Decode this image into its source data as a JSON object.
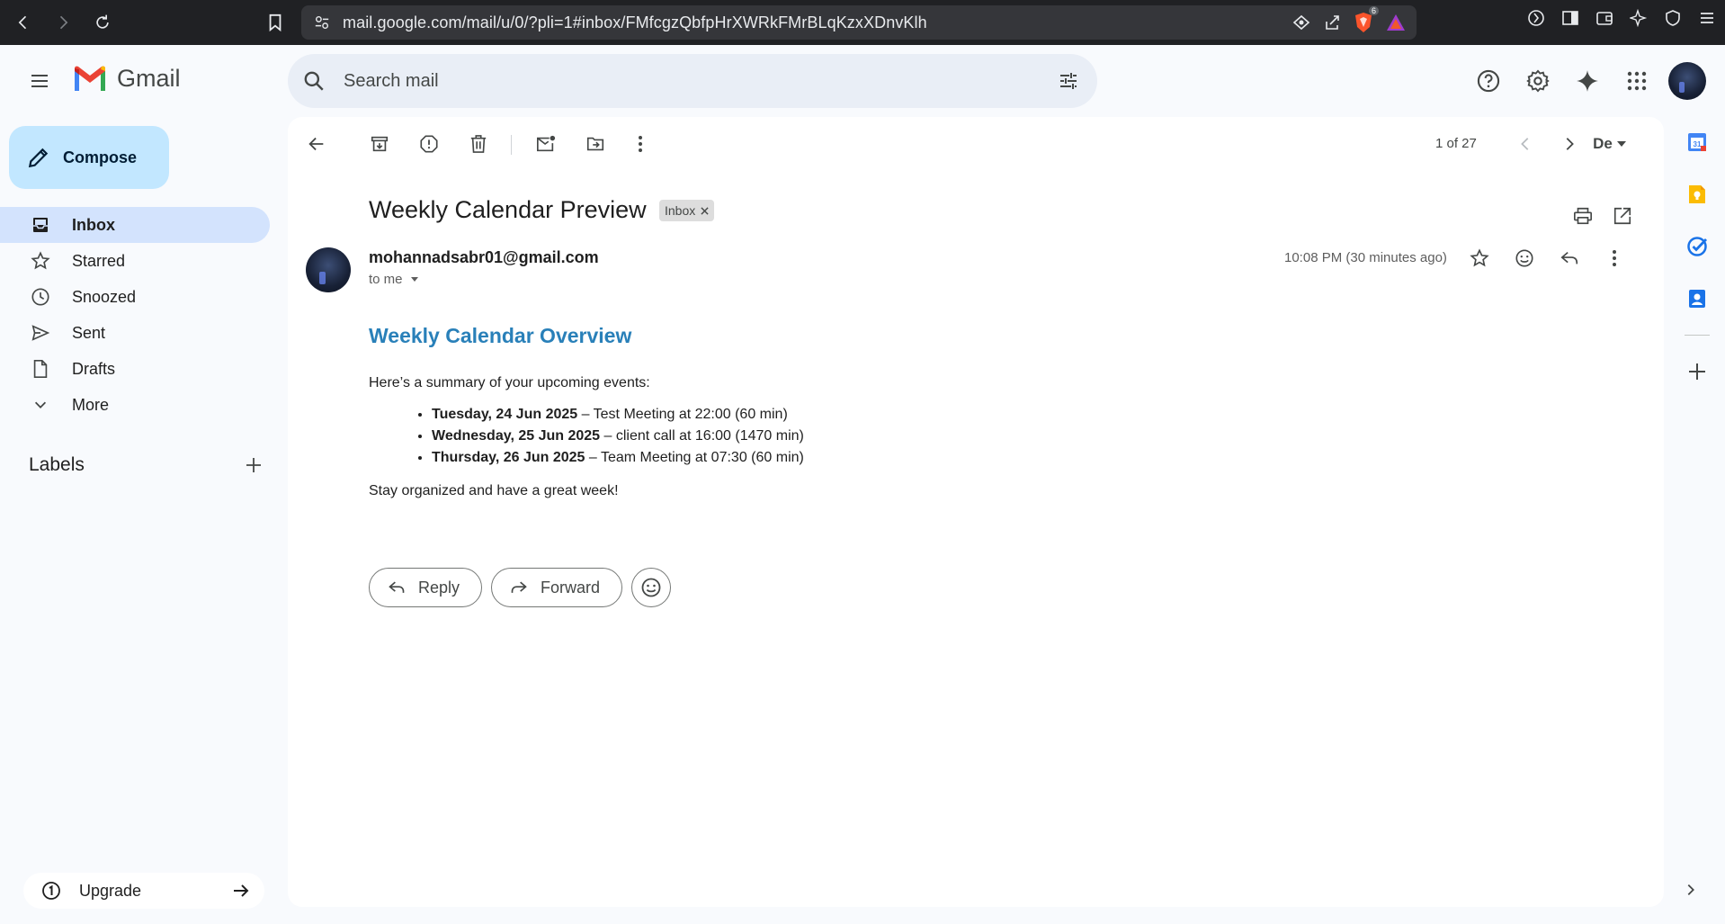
{
  "browser": {
    "url": "mail.google.com/mail/u/0/?pli=1#inbox/FMfcgzQbfpHrXWRkFMrBLqKzxXDnvKlh",
    "brave_shield_count": "6"
  },
  "app": {
    "name": "Gmail",
    "search_placeholder": "Search mail"
  },
  "sidebar": {
    "compose_label": "Compose",
    "items": [
      {
        "label": "Inbox",
        "icon": "inbox-icon"
      },
      {
        "label": "Starred",
        "icon": "star-icon"
      },
      {
        "label": "Snoozed",
        "icon": "clock-icon"
      },
      {
        "label": "Sent",
        "icon": "send-icon"
      },
      {
        "label": "Drafts",
        "icon": "draft-icon"
      },
      {
        "label": "More",
        "icon": "chevron-down-icon"
      }
    ],
    "active_item": "Inbox",
    "labels_heading": "Labels",
    "upgrade_label": "Upgrade"
  },
  "toolbar": {
    "pager": "1 of 27",
    "input_tool": "De"
  },
  "email": {
    "subject": "Weekly Calendar Preview",
    "label_chip": "Inbox",
    "sender": "mohannadsabr01@gmail.com",
    "recipient": "to me",
    "time": "10:08 PM (30 minutes ago)",
    "heading": "Weekly Calendar Overview",
    "intro": "Here’s a summary of your upcoming events:",
    "events": [
      {
        "date": "Tuesday, 24 Jun 2025",
        "detail": " – Test Meeting at 22:00 (60 min)"
      },
      {
        "date": "Wednesday, 25 Jun 2025",
        "detail": " – client call at 16:00 (1470 min)"
      },
      {
        "date": "Thursday, 26 Jun 2025",
        "detail": " – Team Meeting at 07:30 (60 min)"
      }
    ],
    "closing": "Stay organized and have a great week!"
  },
  "actions": {
    "reply_label": "Reply",
    "forward_label": "Forward"
  },
  "colors": {
    "accent_compose": "#c2e7ff",
    "active_nav": "#d3e3fd",
    "heading_blue": "#2980b9"
  }
}
